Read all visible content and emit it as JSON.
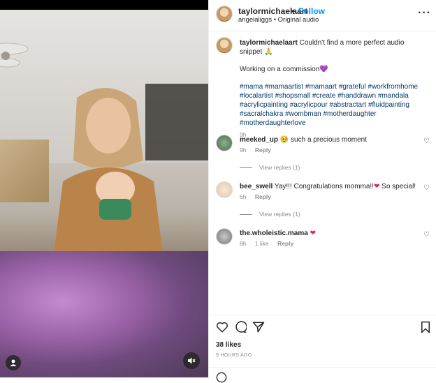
{
  "header": {
    "username": "taylormichaelaart",
    "separator": "•",
    "follow_label": "Follow",
    "subtitle": "angelaliggs • Original audio"
  },
  "caption": {
    "username": "taylormichaelaart",
    "line1": "Couldn't find a more perfect audio snippet",
    "line1_emoji": "🙏",
    "line2": "Working on a commission",
    "line2_emoji": "💜",
    "hashtags": "#mama #mamaartist #mamaart #grateful #workfromhome #localartist #shopsmall #create #handdrawn #mandala #acrylicpainting #acrylicpour #abstractart #fluidpainting #sacralchakra #wombman #motherdaughter #motherdaughterlove",
    "time": "9h"
  },
  "comments": [
    {
      "username": "meeked_up",
      "text": "such a precious moment",
      "emoji": "🥹",
      "time": "9h",
      "likes": "",
      "reply_label": "Reply",
      "view_replies": "View replies (1)"
    },
    {
      "username": "bee_swell",
      "text": "Yay!!! Congratulations momma!!",
      "text2": "So special!",
      "emoji": "❤",
      "time": "6h",
      "likes": "",
      "reply_label": "Reply",
      "view_replies": "View replies (1)"
    },
    {
      "username": "the.wholeistic.mama",
      "text": "",
      "emoji": "❤",
      "time": "8h",
      "likes": "1 like",
      "reply_label": "Reply"
    }
  ],
  "likes_count": "38 likes",
  "posted_ago": "9 HOURS AGO",
  "icons": [
    "heart-icon",
    "comment-icon",
    "share-icon",
    "bookmark-icon",
    "more-icon",
    "mute-icon",
    "user-tag-icon"
  ],
  "colors": {
    "follow": "#0095f6",
    "hashtag": "#00376b",
    "muted_text": "#8e8e8e",
    "heart_red": "#e0245e"
  }
}
